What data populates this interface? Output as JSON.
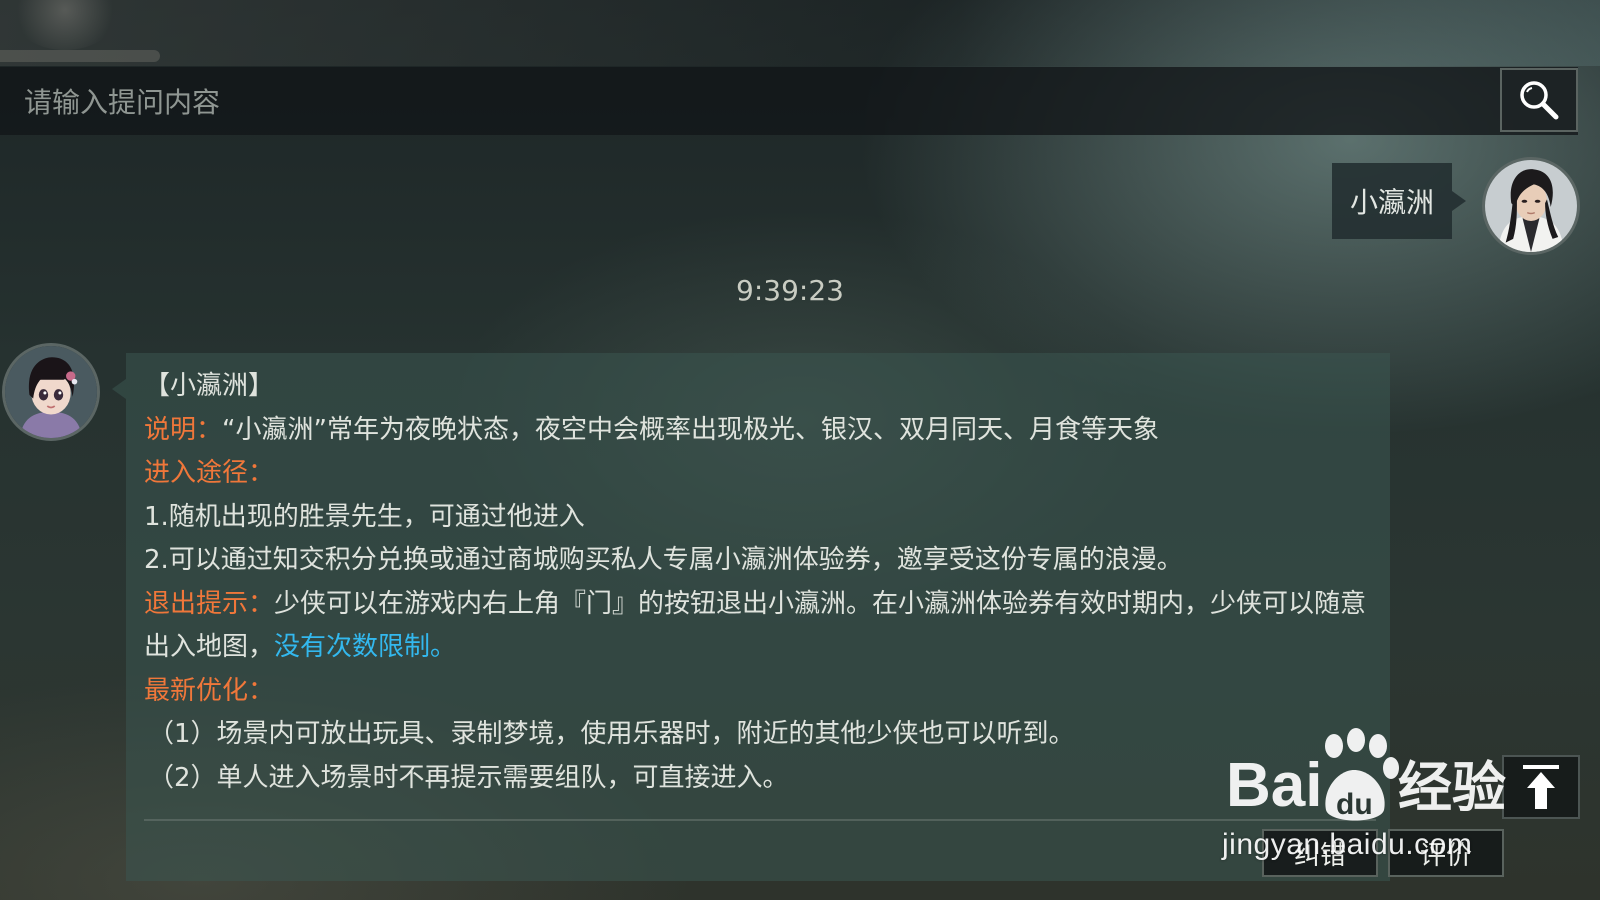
{
  "search": {
    "placeholder": "请输入提问内容",
    "button_icon": "search-icon"
  },
  "user_message": {
    "text": "小瀛洲",
    "avatar_icon": "user-avatar"
  },
  "timestamp": "9:39:23",
  "answer": {
    "avatar_icon": "npc-avatar",
    "title": "【小瀛洲】",
    "description_label": "说明：",
    "description_text": "“小瀛洲”常年为夜晚状态，夜空中会概率出现极光、银汉、双月同天、月食等天象",
    "entry_label": "进入途径：",
    "entry_items": [
      "1.随机出现的胜景先生，可通过他进入",
      "2.可以通过知交积分兑换或通过商城购买私人专属小瀛洲体验券，邀享受这份专属的浪漫。"
    ],
    "exit_label": "退出提示：",
    "exit_text": "少侠可以在游戏内右上角『门』的按钮退出小瀛洲。在小瀛洲体验券有效时期内，少侠可以随意出入地图，",
    "exit_highlight": "没有次数限制。",
    "update_label": "最新优化：",
    "update_items": [
      "（1）场景内可放出玩具、录制梦境，使用乐器时，附近的其他少侠也可以听到。",
      "（2）单人进入场景时不再提示需要组队，可直接进入。"
    ],
    "buttons": {
      "correct": "纠错",
      "rate": "评价"
    }
  },
  "scroll_top_icon": "arrow-up-icon",
  "watermark": {
    "logo_text": "Baidu经验",
    "url": "jingyan.baidu.com"
  },
  "colors": {
    "label_orange": "#f0773a",
    "link_blue": "#33b8ee",
    "text": "#dfe3dd"
  }
}
